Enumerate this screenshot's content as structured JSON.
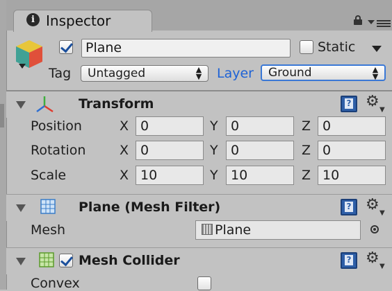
{
  "window": {
    "tab_title": "Inspector"
  },
  "header": {
    "active": true,
    "name": "Plane",
    "static_label": "Static",
    "static_checked": false,
    "tag_label": "Tag",
    "tag_value": "Untagged",
    "layer_label": "Layer",
    "layer_value": "Ground"
  },
  "components": {
    "transform": {
      "title": "Transform",
      "rows": [
        {
          "label": "Position",
          "x": "0",
          "y": "0",
          "z": "0"
        },
        {
          "label": "Rotation",
          "x": "0",
          "y": "0",
          "z": "0"
        },
        {
          "label": "Scale",
          "x": "10",
          "y": "10",
          "z": "10"
        }
      ],
      "axes": {
        "x": "X",
        "y": "Y",
        "z": "Z"
      }
    },
    "mesh_filter": {
      "title": "Plane (Mesh Filter)",
      "mesh_label": "Mesh",
      "mesh_value": "Plane"
    },
    "mesh_collider": {
      "title": "Mesh Collider",
      "enabled": true,
      "convex_label": "Convex",
      "convex_checked": false
    }
  },
  "icons": {
    "info": "info-icon",
    "lock": "lock-icon",
    "menu": "menu-icon",
    "help": "help-icon",
    "gear": "gear-icon",
    "help_glyph": "?",
    "gear_glyph": "⚙",
    "tab_info_glyph": "i"
  },
  "colors": {
    "panel": "#c2c2c2",
    "tabbar": "#a6a6a6",
    "accent": "#3a78d6",
    "layer_label": "#1d62d6"
  }
}
